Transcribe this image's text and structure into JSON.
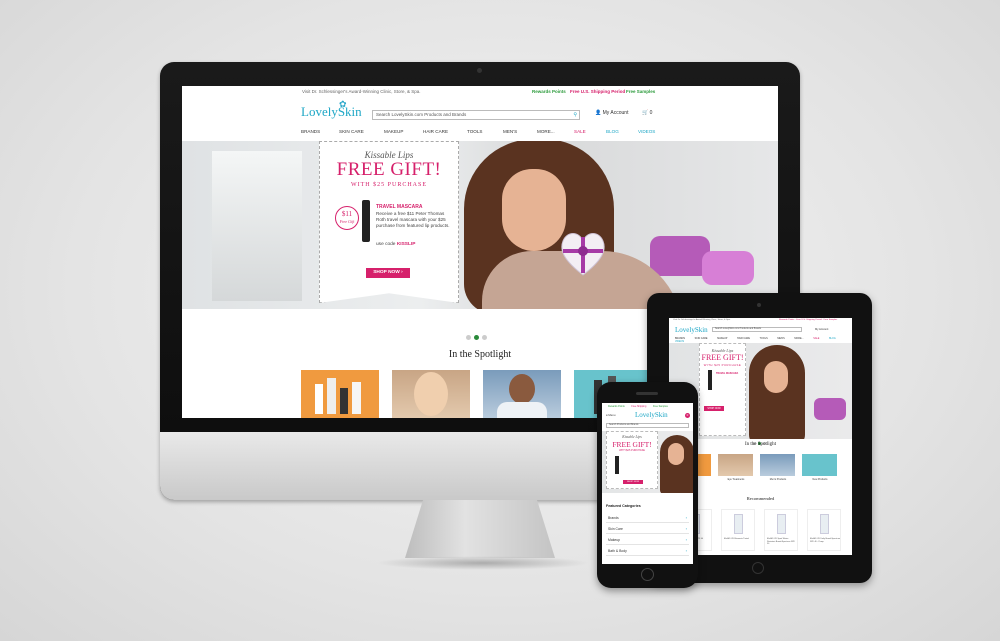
{
  "desktop": {
    "topbar": {
      "left_text": "Visit Dr. Schlessinger's Award-Winning Clinic, Store, & Spa.",
      "rewards": "Rewards Points",
      "shipping": "Free U.S. Shipping Period",
      "samples": "Free Samples"
    },
    "logo": {
      "part1": "Lovely",
      "part2": "Skin"
    },
    "search": {
      "placeholder": "Search LovelySkin.com Products and Brands"
    },
    "account_label": "My Account",
    "cart_count": "0",
    "nav": [
      "BRANDS",
      "SKIN CARE",
      "MAKEUP",
      "HAIR CARE",
      "TOOLS",
      "MEN'S",
      "MORE...",
      "SALE",
      "BLOG",
      "VIDEOS"
    ],
    "promo": {
      "kicker": "Kissable Lips",
      "headline": "FREE GIFT!",
      "sub": "WITH $25 PURCHASE",
      "badge_price": "$11",
      "badge_text": "Free Gift",
      "item_title": "TRAVEL MASCARA",
      "item_text": "Receive a free $11 Peter Thomas Roth travel mascara with your $25 purchase from featured lip products.",
      "code_prefix": "use code",
      "code": "KISSLIP",
      "button": "SHOP NOW"
    },
    "spotlight_title": "In the Spotlight"
  },
  "tablet": {
    "topbar_left": "Visit Dr. Schlessinger's Award-Winning Clinic, Store, & Spa.",
    "topbar_right": "Rewards Points · Free U.S. Shipping Period · Free Samples",
    "logo": "LovelySkin",
    "search": "Search LovelySkin.com Products and Brands",
    "account": "My Account",
    "nav": [
      "BRANDS",
      "SKIN CARE",
      "MAKEUP",
      "HAIR CARE",
      "TOOLS",
      "MEN'S",
      "MORE...",
      "SALE",
      "BLOG",
      "VIDEOS"
    ],
    "promo_kicker": "Kissable Lips",
    "promo_headline": "FREE GIFT!",
    "promo_sub": "WITH $25 PURCHASE",
    "promo_item": "TRAVEL MASCARA",
    "promo_button": "SHOP NOW",
    "spotlight_title": "In the Spotlight",
    "spotlight_captions": [
      "",
      "Eye Treatments",
      "Men's Products",
      "New Products"
    ],
    "recommended_title": "Recommended",
    "products": [
      "EltaMD UV Daily SPF 40",
      "EltaMD UV Elements Tinted",
      "EltaMD UV Sport Water-Resistant Broad-Spectrum SPF 50",
      "EltaMD UV Daily Broad-Spectrum SPF 40 - Pump"
    ]
  },
  "phone": {
    "topbar": {
      "rewards": "Rewards Points",
      "shipping": "Free Shipping",
      "samples": "Free Samples"
    },
    "menu_label": "≡ Menu",
    "logo": "LovelySkin",
    "cart_count": "0",
    "search": "Search Products and Brands",
    "promo_kicker": "Kissable Lips",
    "promo_headline": "FREE GIFT!",
    "promo_sub": "WITH $25 PURCHASE",
    "promo_button": "SHOP NOW",
    "featured_title": "Featured Categories",
    "categories": [
      "Brands",
      "Skin Care",
      "Makeup",
      "Bath & Body"
    ]
  },
  "colors": {
    "brand_teal": "#1ea7c6",
    "brand_pink": "#d6206b",
    "green": "#2a9a3a"
  }
}
